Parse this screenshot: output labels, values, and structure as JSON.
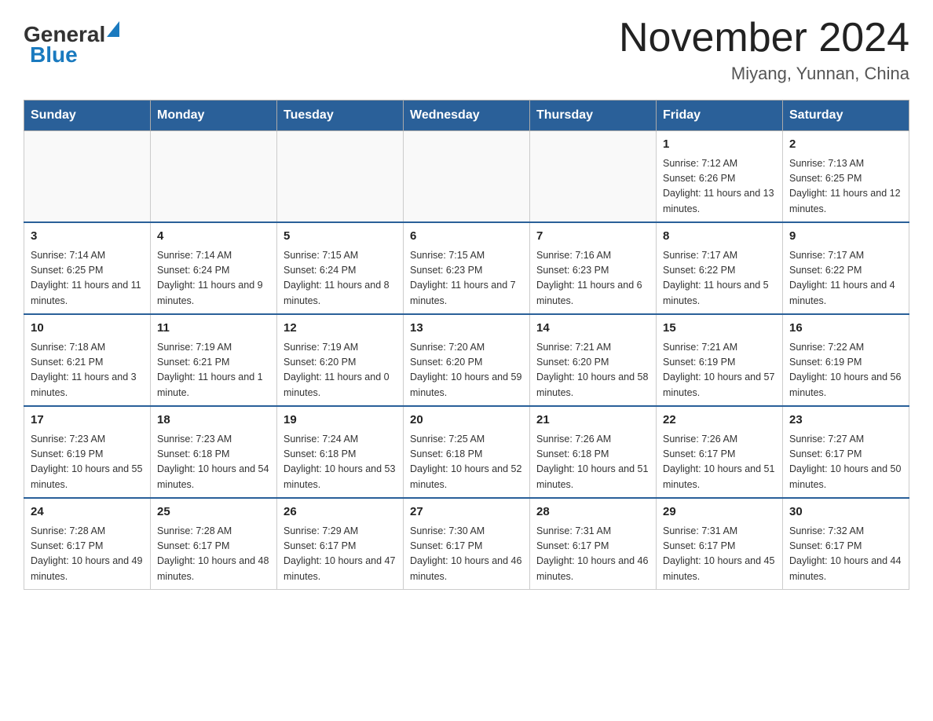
{
  "header": {
    "logo_general": "General",
    "logo_blue": "Blue",
    "month_title": "November 2024",
    "location": "Miyang, Yunnan, China"
  },
  "days_of_week": [
    "Sunday",
    "Monday",
    "Tuesday",
    "Wednesday",
    "Thursday",
    "Friday",
    "Saturday"
  ],
  "weeks": [
    [
      {
        "day": "",
        "info": ""
      },
      {
        "day": "",
        "info": ""
      },
      {
        "day": "",
        "info": ""
      },
      {
        "day": "",
        "info": ""
      },
      {
        "day": "",
        "info": ""
      },
      {
        "day": "1",
        "info": "Sunrise: 7:12 AM\nSunset: 6:26 PM\nDaylight: 11 hours and 13 minutes."
      },
      {
        "day": "2",
        "info": "Sunrise: 7:13 AM\nSunset: 6:25 PM\nDaylight: 11 hours and 12 minutes."
      }
    ],
    [
      {
        "day": "3",
        "info": "Sunrise: 7:14 AM\nSunset: 6:25 PM\nDaylight: 11 hours and 11 minutes."
      },
      {
        "day": "4",
        "info": "Sunrise: 7:14 AM\nSunset: 6:24 PM\nDaylight: 11 hours and 9 minutes."
      },
      {
        "day": "5",
        "info": "Sunrise: 7:15 AM\nSunset: 6:24 PM\nDaylight: 11 hours and 8 minutes."
      },
      {
        "day": "6",
        "info": "Sunrise: 7:15 AM\nSunset: 6:23 PM\nDaylight: 11 hours and 7 minutes."
      },
      {
        "day": "7",
        "info": "Sunrise: 7:16 AM\nSunset: 6:23 PM\nDaylight: 11 hours and 6 minutes."
      },
      {
        "day": "8",
        "info": "Sunrise: 7:17 AM\nSunset: 6:22 PM\nDaylight: 11 hours and 5 minutes."
      },
      {
        "day": "9",
        "info": "Sunrise: 7:17 AM\nSunset: 6:22 PM\nDaylight: 11 hours and 4 minutes."
      }
    ],
    [
      {
        "day": "10",
        "info": "Sunrise: 7:18 AM\nSunset: 6:21 PM\nDaylight: 11 hours and 3 minutes."
      },
      {
        "day": "11",
        "info": "Sunrise: 7:19 AM\nSunset: 6:21 PM\nDaylight: 11 hours and 1 minute."
      },
      {
        "day": "12",
        "info": "Sunrise: 7:19 AM\nSunset: 6:20 PM\nDaylight: 11 hours and 0 minutes."
      },
      {
        "day": "13",
        "info": "Sunrise: 7:20 AM\nSunset: 6:20 PM\nDaylight: 10 hours and 59 minutes."
      },
      {
        "day": "14",
        "info": "Sunrise: 7:21 AM\nSunset: 6:20 PM\nDaylight: 10 hours and 58 minutes."
      },
      {
        "day": "15",
        "info": "Sunrise: 7:21 AM\nSunset: 6:19 PM\nDaylight: 10 hours and 57 minutes."
      },
      {
        "day": "16",
        "info": "Sunrise: 7:22 AM\nSunset: 6:19 PM\nDaylight: 10 hours and 56 minutes."
      }
    ],
    [
      {
        "day": "17",
        "info": "Sunrise: 7:23 AM\nSunset: 6:19 PM\nDaylight: 10 hours and 55 minutes."
      },
      {
        "day": "18",
        "info": "Sunrise: 7:23 AM\nSunset: 6:18 PM\nDaylight: 10 hours and 54 minutes."
      },
      {
        "day": "19",
        "info": "Sunrise: 7:24 AM\nSunset: 6:18 PM\nDaylight: 10 hours and 53 minutes."
      },
      {
        "day": "20",
        "info": "Sunrise: 7:25 AM\nSunset: 6:18 PM\nDaylight: 10 hours and 52 minutes."
      },
      {
        "day": "21",
        "info": "Sunrise: 7:26 AM\nSunset: 6:18 PM\nDaylight: 10 hours and 51 minutes."
      },
      {
        "day": "22",
        "info": "Sunrise: 7:26 AM\nSunset: 6:17 PM\nDaylight: 10 hours and 51 minutes."
      },
      {
        "day": "23",
        "info": "Sunrise: 7:27 AM\nSunset: 6:17 PM\nDaylight: 10 hours and 50 minutes."
      }
    ],
    [
      {
        "day": "24",
        "info": "Sunrise: 7:28 AM\nSunset: 6:17 PM\nDaylight: 10 hours and 49 minutes."
      },
      {
        "day": "25",
        "info": "Sunrise: 7:28 AM\nSunset: 6:17 PM\nDaylight: 10 hours and 48 minutes."
      },
      {
        "day": "26",
        "info": "Sunrise: 7:29 AM\nSunset: 6:17 PM\nDaylight: 10 hours and 47 minutes."
      },
      {
        "day": "27",
        "info": "Sunrise: 7:30 AM\nSunset: 6:17 PM\nDaylight: 10 hours and 46 minutes."
      },
      {
        "day": "28",
        "info": "Sunrise: 7:31 AM\nSunset: 6:17 PM\nDaylight: 10 hours and 46 minutes."
      },
      {
        "day": "29",
        "info": "Sunrise: 7:31 AM\nSunset: 6:17 PM\nDaylight: 10 hours and 45 minutes."
      },
      {
        "day": "30",
        "info": "Sunrise: 7:32 AM\nSunset: 6:17 PM\nDaylight: 10 hours and 44 minutes."
      }
    ]
  ]
}
